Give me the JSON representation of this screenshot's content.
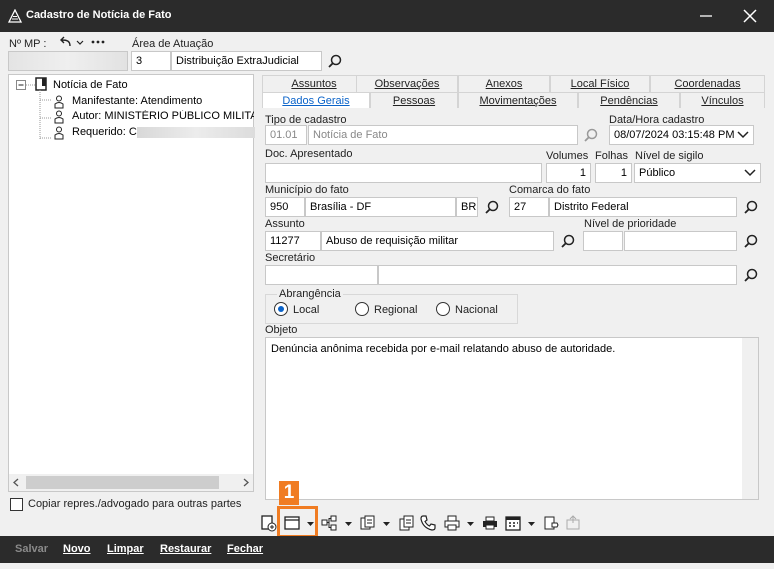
{
  "window": {
    "title": "Cadastro de Notícia de Fato"
  },
  "header": {
    "nmp_label": "Nº MP :",
    "nmp_value": "",
    "area_label": "Área de Atuação",
    "area_code": "3",
    "area_name": "Distribuição ExtraJudicial"
  },
  "tree": {
    "root": "Notícia de Fato",
    "children": [
      "Manifestante: Atendimento",
      "Autor: MINISTÉRIO PÚBLICO MILITAR",
      "Requerido: C"
    ]
  },
  "copy_checkbox_label": "Copiar repres./advogado para outras partes",
  "tabs_row1": [
    "Assuntos",
    "Observações",
    "Anexos",
    "Local Físico",
    "Coordenadas"
  ],
  "tabs_row2": [
    "Dados Gerais",
    "Pessoas",
    "Movimentações",
    "Pendências",
    "Vínculos"
  ],
  "form": {
    "tipo_label": "Tipo de cadastro",
    "tipo_code": "01.01",
    "tipo_name": "Notícia de Fato",
    "datahora_label": "Data/Hora cadastro",
    "datahora_value": "08/07/2024 03:15:48 PM",
    "doc_label": "Doc. Apresentado",
    "volumes_label": "Volumes",
    "volumes_value": "1",
    "folhas_label": "Folhas",
    "folhas_value": "1",
    "sigilo_label": "Nível de sigilo",
    "sigilo_value": "Público",
    "municipio_label": "Município do fato",
    "municipio_code": "950",
    "municipio_name": "Brasília - DF",
    "municipio_uf": "BR",
    "comarca_label": "Comarca do fato",
    "comarca_code": "27",
    "comarca_name": "Distrito Federal",
    "assunto_label": "Assunto",
    "assunto_code": "11277",
    "assunto_name": "Abuso de requisição militar",
    "prioridade_label": "Nível de prioridade",
    "secretario_label": "Secretário",
    "abrangencia_label": "Abrangência",
    "abrangencia_options": [
      "Local",
      "Regional",
      "Nacional"
    ],
    "objeto_label": "Objeto",
    "objeto_text": "Denúncia anônima recebida por e-mail relatando abuso de autoridade."
  },
  "actions": {
    "salvar": "Salvar",
    "novo": "Novo",
    "limpar": "Limpar",
    "restaurar": "Restaurar",
    "fechar": "Fechar"
  },
  "annotation": {
    "number": "1"
  },
  "colors": {
    "titlebar": "#2b2b2b",
    "accent": "#0a63c9",
    "annotation": "#f07c22"
  }
}
